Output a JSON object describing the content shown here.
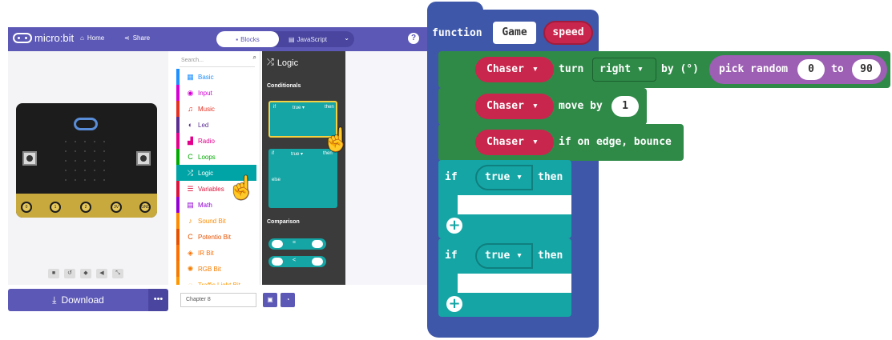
{
  "editor": {
    "brand": "micro:bit",
    "nav": {
      "home": "Home",
      "share": "Share"
    },
    "mode_toggle": {
      "blocks": "Blocks",
      "javascript": "JavaScript"
    },
    "help": "?",
    "simulator": {
      "pins": [
        "0",
        "1",
        "2",
        "3V",
        "GND"
      ],
      "controls": [
        "■",
        "↺",
        "◆",
        "◀",
        "⤡"
      ]
    },
    "download": {
      "label": "Download",
      "more": "•••"
    },
    "toolbox": {
      "search_placeholder": "Search...",
      "categories": [
        {
          "icon": "▦",
          "label": "Basic",
          "color": "#1e90ff"
        },
        {
          "icon": "◉",
          "label": "Input",
          "color": "#d400d4"
        },
        {
          "icon": "♫",
          "label": "Music",
          "color": "#e63022"
        },
        {
          "icon": "◐",
          "label": "Led",
          "color": "#5c2d91"
        },
        {
          "icon": "▟",
          "label": "Radio",
          "color": "#e3008c"
        },
        {
          "icon": "C",
          "label": "Loops",
          "color": "#00aa00"
        },
        {
          "icon": "⤮",
          "label": "Logic",
          "color": "#00a4a6"
        },
        {
          "icon": "☰",
          "label": "Variables",
          "color": "#dc143c"
        },
        {
          "icon": "▤",
          "label": "Math",
          "color": "#9400d3"
        },
        {
          "icon": "♪",
          "label": "Sound Bit",
          "color": "#ff8c00"
        },
        {
          "icon": "C",
          "label": "Potentio Bit",
          "color": "#e65100"
        },
        {
          "icon": "◈",
          "label": "IR Bit",
          "color": "#ff6f00"
        },
        {
          "icon": "✺",
          "label": "RGB Bit",
          "color": "#f57c00"
        },
        {
          "icon": "◌",
          "label": "Traffic Light Bit",
          "color": "#ff9800"
        }
      ]
    },
    "flyout": {
      "title": "Logic",
      "section_conditionals": "Conditionals",
      "section_comparison": "Comparison",
      "if_label": "if",
      "true_label": "true ▾",
      "then_label": "then",
      "else_label": "else",
      "ops": [
        "=",
        "<"
      ]
    },
    "project_name": "Chapter 8"
  },
  "blocks": {
    "function_kw": "function",
    "function_name": "Game",
    "param": "speed",
    "rows": [
      {
        "sprite": "Chaser",
        "text1": "turn",
        "dir": "right",
        "text2": "by (°)",
        "random": "pick random",
        "from": "0",
        "to_kw": "to",
        "to": "90"
      },
      {
        "sprite": "Chaser",
        "text1": "move by",
        "value": "1"
      },
      {
        "sprite": "Chaser",
        "text1": "if on edge, bounce"
      }
    ],
    "if_blocks": [
      {
        "if_kw": "if",
        "cond": "true",
        "then_kw": "then",
        "plus": "+"
      },
      {
        "if_kw": "if",
        "cond": "true",
        "then_kw": "then",
        "plus": "+"
      }
    ]
  }
}
